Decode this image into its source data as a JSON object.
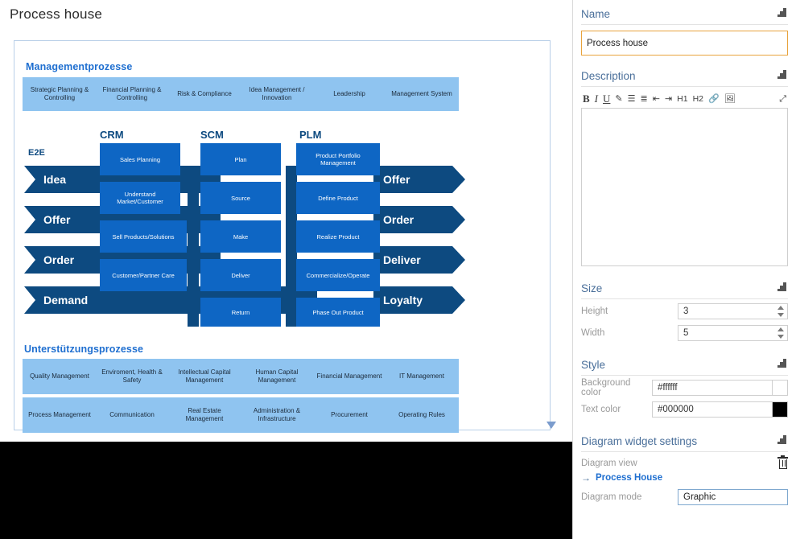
{
  "canvas": {
    "title": "Process house"
  },
  "diagram": {
    "management_header": "Managementprozesse",
    "support_header": "Unterstützungsprozesse",
    "e2e_label": "E2E",
    "column_labels": [
      "CRM",
      "SCM",
      "PLM"
    ],
    "management_boxes": [
      "Strategic Planning & Controlling",
      "Financial Planning & Controlling",
      "Risk & Compliance",
      "Idea Management / Innovation",
      "Leadership",
      "Management System"
    ],
    "e2e_left": [
      "Idea",
      "Offer",
      "Order",
      "Demand"
    ],
    "e2e_right": [
      "Offer",
      "Order",
      "Deliver",
      "Loyalty"
    ],
    "crm_boxes": [
      "Sales Planning",
      "Understand Market/Customer",
      "Sell Products/Solutions",
      "Customer/Partner Care"
    ],
    "scm_boxes": [
      "Plan",
      "Source",
      "Make",
      "Deliver",
      "Return"
    ],
    "plm_boxes": [
      "Product Portfolio Management",
      "Define Product",
      "Realize Product",
      "Commercialize/Operate",
      "Phase Out Product"
    ],
    "support_boxes_row1": [
      "Quality Management",
      "Enviroment, Health & Safety",
      "Intellectual Capital Management",
      "Human Capital Management",
      "Financial Management",
      "IT Management"
    ],
    "support_boxes_row2": [
      "Process Management",
      "Communication",
      "Real Estate Management",
      "Administration & Infrastructure",
      "Procurement",
      "Operating Rules"
    ],
    "colors": {
      "light_blue": "#8fc4f0",
      "core_blue": "#0e66c4",
      "dark_blue": "#0d4a80",
      "heading_blue": "#1f6fd0"
    }
  },
  "panel": {
    "name": {
      "title": "Name",
      "value": "Process house"
    },
    "description": {
      "title": "Description",
      "value": "",
      "toolbar": [
        {
          "name": "bold-icon",
          "glyph": "B",
          "cls": "b"
        },
        {
          "name": "italic-icon",
          "glyph": "I",
          "cls": "i"
        },
        {
          "name": "underline-icon",
          "glyph": "U",
          "cls": "u"
        },
        {
          "name": "format-brush-icon",
          "glyph": "✎",
          "cls": "sm"
        },
        {
          "name": "bullet-list-icon",
          "glyph": "☰",
          "cls": "sm"
        },
        {
          "name": "numbered-list-icon",
          "glyph": "≣",
          "cls": "sm"
        },
        {
          "name": "decrease-indent-icon",
          "glyph": "⇤",
          "cls": "sm"
        },
        {
          "name": "increase-indent-icon",
          "glyph": "⇥",
          "cls": "sm"
        },
        {
          "name": "heading-1-icon",
          "glyph": "H1",
          "cls": "h"
        },
        {
          "name": "heading-2-icon",
          "glyph": "H2",
          "cls": "h"
        },
        {
          "name": "link-icon",
          "glyph": "🔗",
          "cls": "sm"
        },
        {
          "name": "image-icon",
          "glyph": "🖼",
          "cls": "sm"
        }
      ],
      "expand_glyph": "⤢"
    },
    "size": {
      "title": "Size",
      "height_label": "Height",
      "height_value": "3",
      "width_label": "Width",
      "width_value": "5"
    },
    "style": {
      "title": "Style",
      "background_label": "Background color",
      "background_value": "#ffffff",
      "text_label": "Text color",
      "text_value": "#000000"
    },
    "diagram_widget": {
      "title": "Diagram widget settings",
      "view_label": "Diagram view",
      "view_link": "Process House",
      "mode_label": "Diagram mode",
      "mode_value": "Graphic"
    }
  }
}
